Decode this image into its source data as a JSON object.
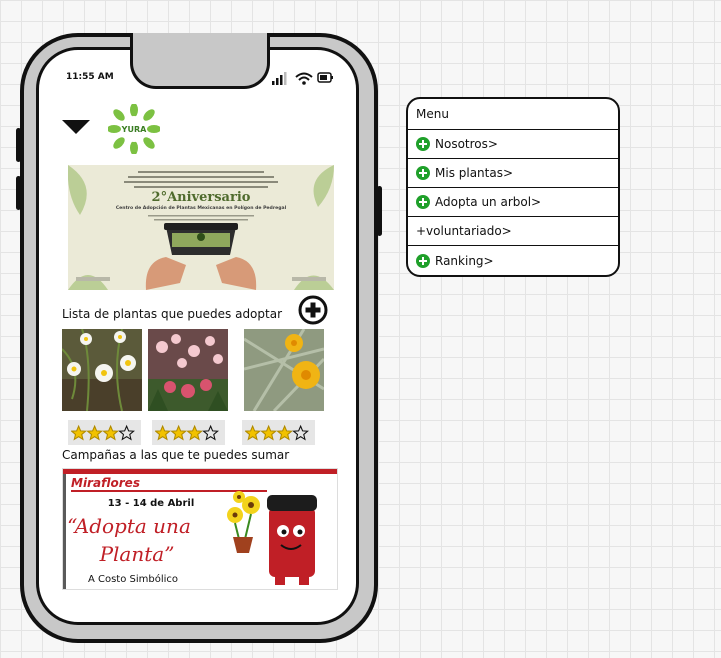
{
  "status": {
    "time": "11:55 AM"
  },
  "header": {
    "logo_text": "YURA"
  },
  "banner": {
    "headline": "2°Aniversario",
    "subtitle": "Centro de Adopción de Plantas Mexicanas en Polígon de Pedregal"
  },
  "plants": {
    "title": "Lista de plantas que puedes adoptar",
    "items": [
      {
        "name": "margaritas blancas",
        "rating": 3,
        "max": 5
      },
      {
        "name": "flores rosadas",
        "rating": 3,
        "max": 5
      },
      {
        "name": "flor amarilla",
        "rating": 3,
        "max": 5
      }
    ]
  },
  "campaigns": {
    "title": "Campañas a las que te puedes sumar",
    "brand": "Miraflores",
    "dates": "13 - 14 de Abril",
    "line1": "“Adopta una",
    "line2": "Planta”",
    "cost": "A Costo Simbólico"
  },
  "menu": {
    "title": "Menu",
    "items": [
      {
        "label": "Nosotros>",
        "icon": "plus-circle-icon"
      },
      {
        "label": "Mis plantas>",
        "icon": "plus-circle-icon"
      },
      {
        "label": "Adopta un arbol>",
        "icon": "plus-circle-icon"
      },
      {
        "label": "+voluntariado>",
        "icon": ""
      },
      {
        "label": "Ranking>",
        "icon": "plus-circle-icon"
      }
    ]
  },
  "colors": {
    "accent_green": "#1fa02a",
    "star_yellow": "#f2c200",
    "brand_red": "#d42a2a"
  }
}
